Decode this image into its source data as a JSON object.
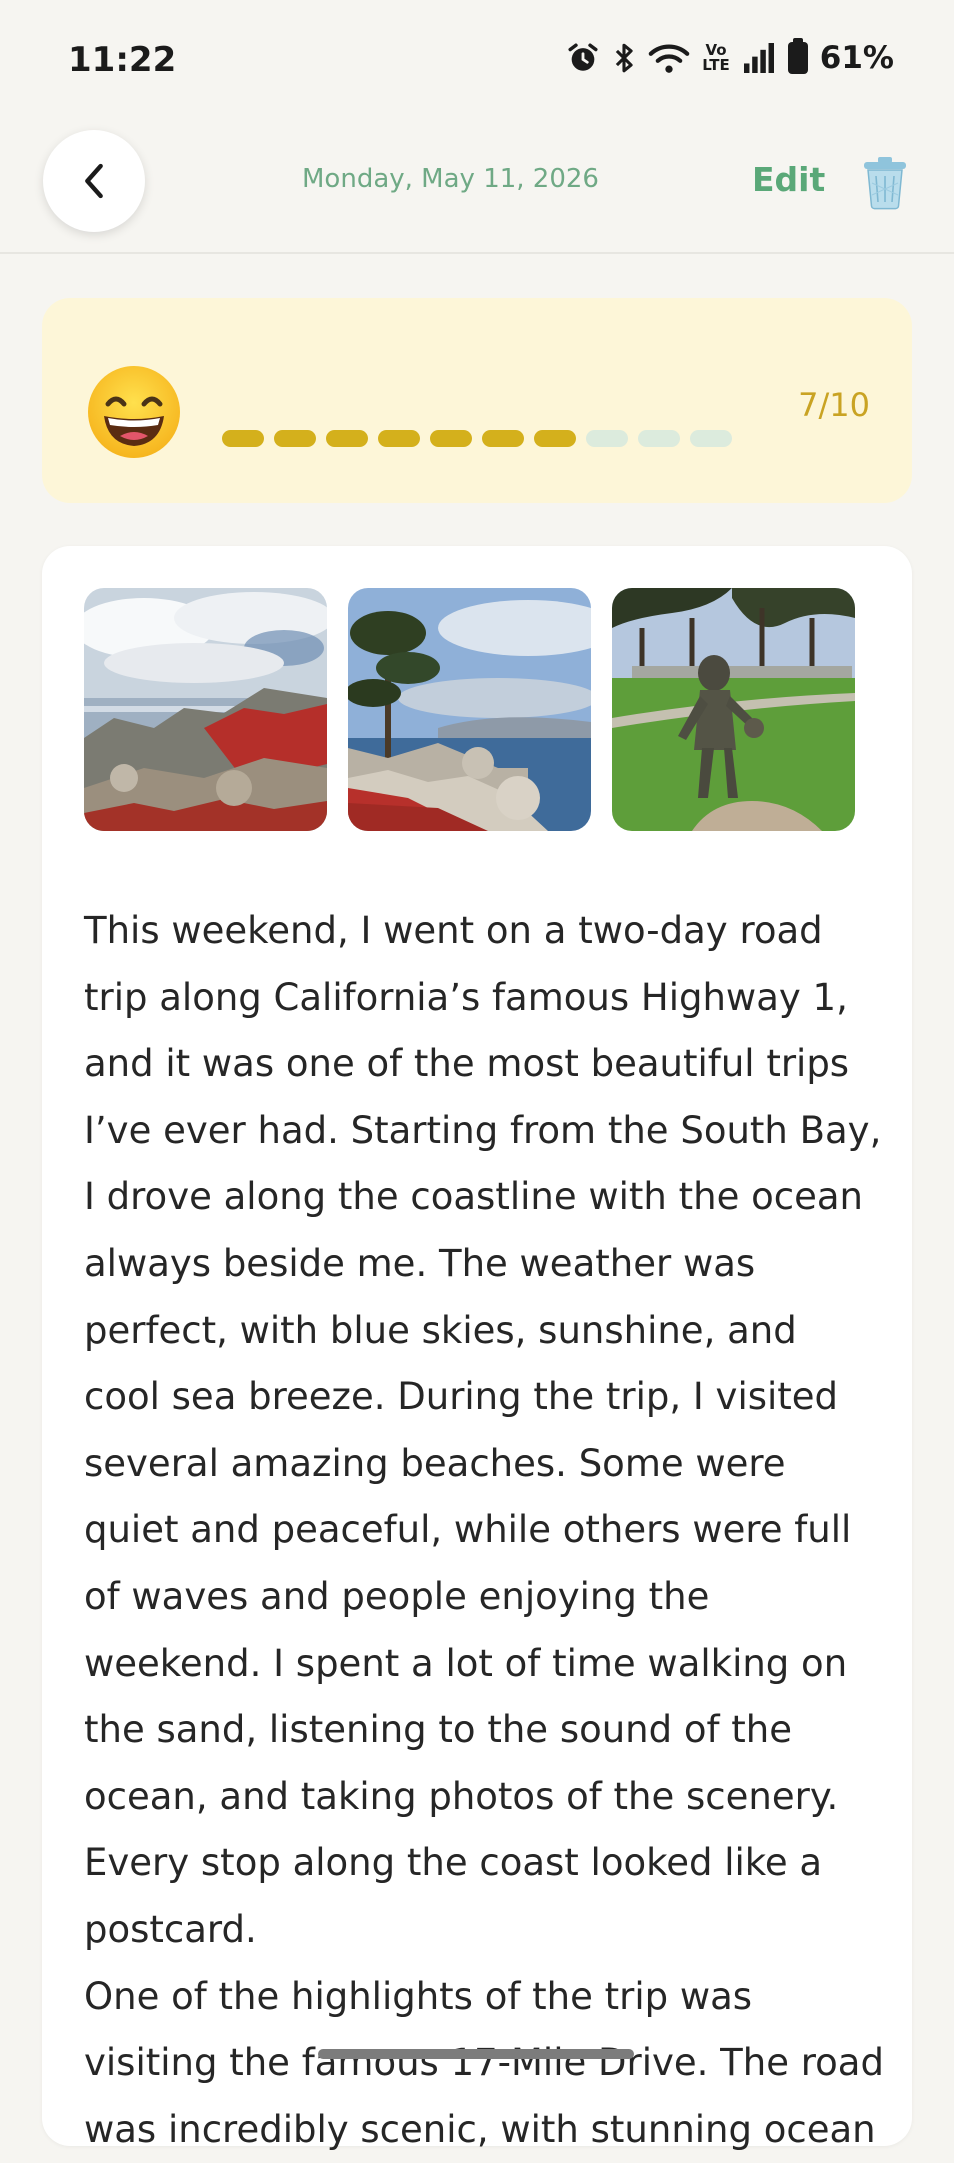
{
  "status_bar": {
    "time": "11:22",
    "volte_top": "Vo",
    "volte_bottom": "LTE",
    "battery": "61%",
    "icons": [
      "alarm-icon",
      "bluetooth-icon",
      "wifi-icon",
      "volte-icon",
      "signal-icon",
      "battery-icon"
    ]
  },
  "header": {
    "date": "Monday, May 11, 2026",
    "edit_label": "Edit",
    "back_icon": "chevron-left-icon",
    "trash_icon": "trash-icon"
  },
  "mood": {
    "emoji_icon": "grinning-face-icon",
    "score": 7,
    "max": 10,
    "score_text": "7/10",
    "colors": {
      "filled": "#d4b01c",
      "empty": "#dcebdd",
      "card": "#fdf6d8"
    }
  },
  "photos": [
    {
      "name": "coast-rocks-photo",
      "description_icon": "photo-icon"
    },
    {
      "name": "cypress-tree-photo",
      "description_icon": "photo-icon"
    },
    {
      "name": "statue-park-photo",
      "description_icon": "photo-icon"
    }
  ],
  "entry": {
    "paragraphs": [
      "This weekend, I went on a two-day road trip along California’s famous Highway 1, and it was one of the most beautiful trips I’ve ever had. Starting from the South Bay, I drove along the coastline with the ocean always beside me. The weather was perfect, with blue skies, sunshine, and cool sea breeze. During the trip, I visited several amazing beaches. Some were quiet and peaceful, while others were full of waves and people enjoying the weekend. I spent a lot of time walking on the sand, listening to the sound of the ocean, and taking photos of the scenery. Every stop along the coast looked like a postcard.",
      "One of the highlights of the trip was visiting the famous 17-Mile Drive. The road was incredibly scenic, with stunning ocean"
    ]
  },
  "colors": {
    "accent": "#5aa878",
    "date": "#6fa985",
    "background": "#f6f5f1"
  }
}
